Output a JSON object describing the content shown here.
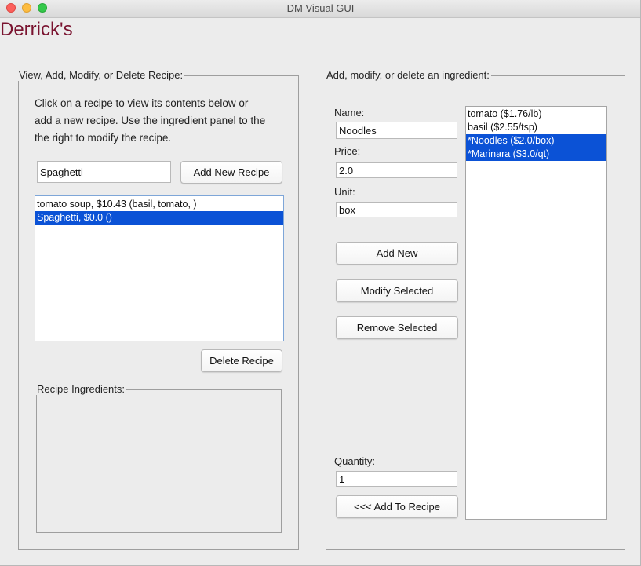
{
  "window": {
    "title": "DM Visual GUI"
  },
  "app": {
    "title": "Derrick's"
  },
  "recipe_panel": {
    "legend": "View, Add, Modify, or Delete Recipe:",
    "instructions": [
      "Click on a recipe to view its contents below or",
      "add a new recipe. Use the ingredient panel to the",
      "the right to modify the recipe."
    ],
    "recipe_name_value": "Spaghetti",
    "add_button_label": "Add New Recipe",
    "recipes": [
      {
        "text": "tomato soup, $10.43 (basil, tomato, )",
        "selected": false
      },
      {
        "text": "Spaghetti, $0.0 ()",
        "selected": true
      }
    ],
    "delete_button_label": "Delete Recipe",
    "ingredients_legend": "Recipe Ingredients:"
  },
  "ingredient_panel": {
    "legend": "Add, modify, or delete an ingredient:",
    "name_label": "Name:",
    "name_value": "Noodles",
    "price_label": "Price:",
    "price_value": "2.0",
    "unit_label": "Unit:",
    "unit_value": "box",
    "add_button_label": "Add New",
    "modify_button_label": "Modify Selected",
    "remove_button_label": "Remove Selected",
    "quantity_label": "Quantity:",
    "quantity_value": "1",
    "add_to_recipe_label": "<<<   Add To Recipe",
    "ingredients": [
      {
        "text": "tomato ($1.76/lb)",
        "selected": false
      },
      {
        "text": "basil ($2.55/tsp)",
        "selected": false
      },
      {
        "text": "*Noodles ($2.0/box)",
        "selected": true
      },
      {
        "text": "*Marinara ($3.0/qt)",
        "selected": true
      }
    ]
  },
  "colors": {
    "selection": "#0b52d6",
    "app_title": "#7a1430",
    "window_bg": "#ececec",
    "close": "#fc605c",
    "minimize": "#fdbc40",
    "maximize": "#34c84a"
  }
}
